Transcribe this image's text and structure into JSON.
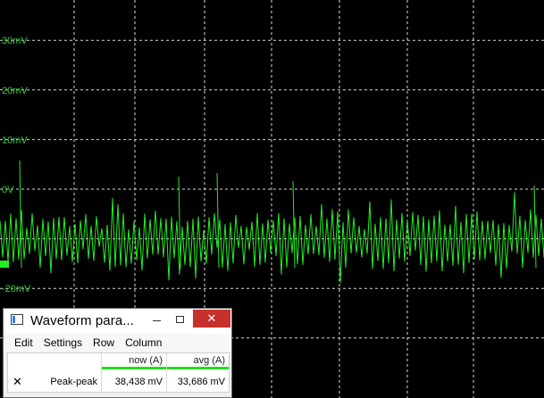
{
  "scope": {
    "grid_color": "#d8d8d8",
    "trace_color": "#22ee22",
    "label_color": "#3cc83c",
    "y_labels": [
      "30mV",
      "20mV",
      "10mV",
      "0V",
      "-20mV"
    ],
    "y_values": [
      30,
      20,
      10,
      0,
      -20
    ]
  },
  "window": {
    "title": "Waveform para...",
    "close_label": "✕",
    "menu": [
      "Edit",
      "Settings",
      "Row",
      "Column"
    ],
    "columns": [
      "now (A)",
      "avg (A)"
    ],
    "rows": [
      {
        "name": "Peak-peak",
        "now": "38,438 mV",
        "avg": "33,686 mV",
        "remove_label": "✕"
      }
    ],
    "accent": "#22dd22"
  }
}
